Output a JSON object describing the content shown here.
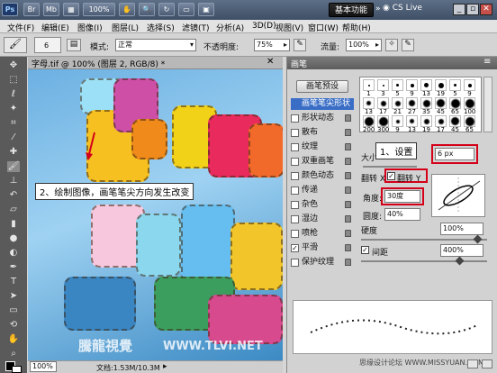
{
  "titlebar": {
    "ps": "Ps",
    "br": "Br",
    "mb": "Mb",
    "zoom": "100%",
    "workspace": "基本功能",
    "cslive": "CS Live"
  },
  "menu": [
    "文件(F)",
    "编辑(E)",
    "图像(I)",
    "图层(L)",
    "选择(S)",
    "滤镜(T)",
    "分析(A)",
    "3D(D)",
    "视图(V)",
    "窗口(W)",
    "帮助(H)"
  ],
  "options": {
    "brush_size": "6",
    "mode_label": "模式:",
    "mode_value": "正常",
    "opacity_label": "不透明度:",
    "opacity_value": "75%",
    "flow_label": "流量:",
    "flow_value": "100%"
  },
  "document": {
    "tab": "字母.tif @ 100% (图层 2, RGB/8) *",
    "zoom": "100%",
    "doc_size": "文档:1.53M/10.3M"
  },
  "annotations": {
    "step1": "1、设置",
    "step2": "2、绘制图像，画笔笔尖方向发生改变"
  },
  "brush_panel": {
    "title": "画笔",
    "preset_button": "画笔预设",
    "items": [
      {
        "label": "画笔笔尖形状",
        "checked": false,
        "selected": true
      },
      {
        "label": "形状动态",
        "checked": false
      },
      {
        "label": "散布",
        "checked": false
      },
      {
        "label": "纹理",
        "checked": false
      },
      {
        "label": "双重画笔",
        "checked": false
      },
      {
        "label": "颜色动态",
        "checked": false
      },
      {
        "label": "传递",
        "checked": false
      },
      {
        "label": "杂色",
        "checked": false
      },
      {
        "label": "湿边",
        "checked": false
      },
      {
        "label": "喷枪",
        "checked": false
      },
      {
        "label": "平滑",
        "checked": true
      },
      {
        "label": "保护纹理",
        "checked": false
      }
    ],
    "tip_sizes": [
      "1",
      "3",
      "5",
      "9",
      "13",
      "19",
      "5",
      "9",
      "13",
      "17",
      "21",
      "27",
      "35",
      "45",
      "65",
      "100",
      "200",
      "300",
      "9",
      "13",
      "19",
      "17",
      "45",
      "65"
    ],
    "size_label": "大小",
    "size_value": "6 px",
    "flip_x": "翻转 X",
    "flip_y": "翻转 Y",
    "angle_label": "角度:",
    "angle_value": "30度",
    "roundness_label": "圆度:",
    "roundness_value": "40%",
    "hardness_label": "硬度",
    "hardness_value": "100%",
    "spacing_label": "间距",
    "spacing_value": "400%",
    "spacing_checked": true
  },
  "watermark": {
    "left": "騰龍視覺",
    "right": "WWW.TLVI.NET",
    "missyuan": "思缘设计论坛 WWW.MISSYUAN.COM"
  }
}
